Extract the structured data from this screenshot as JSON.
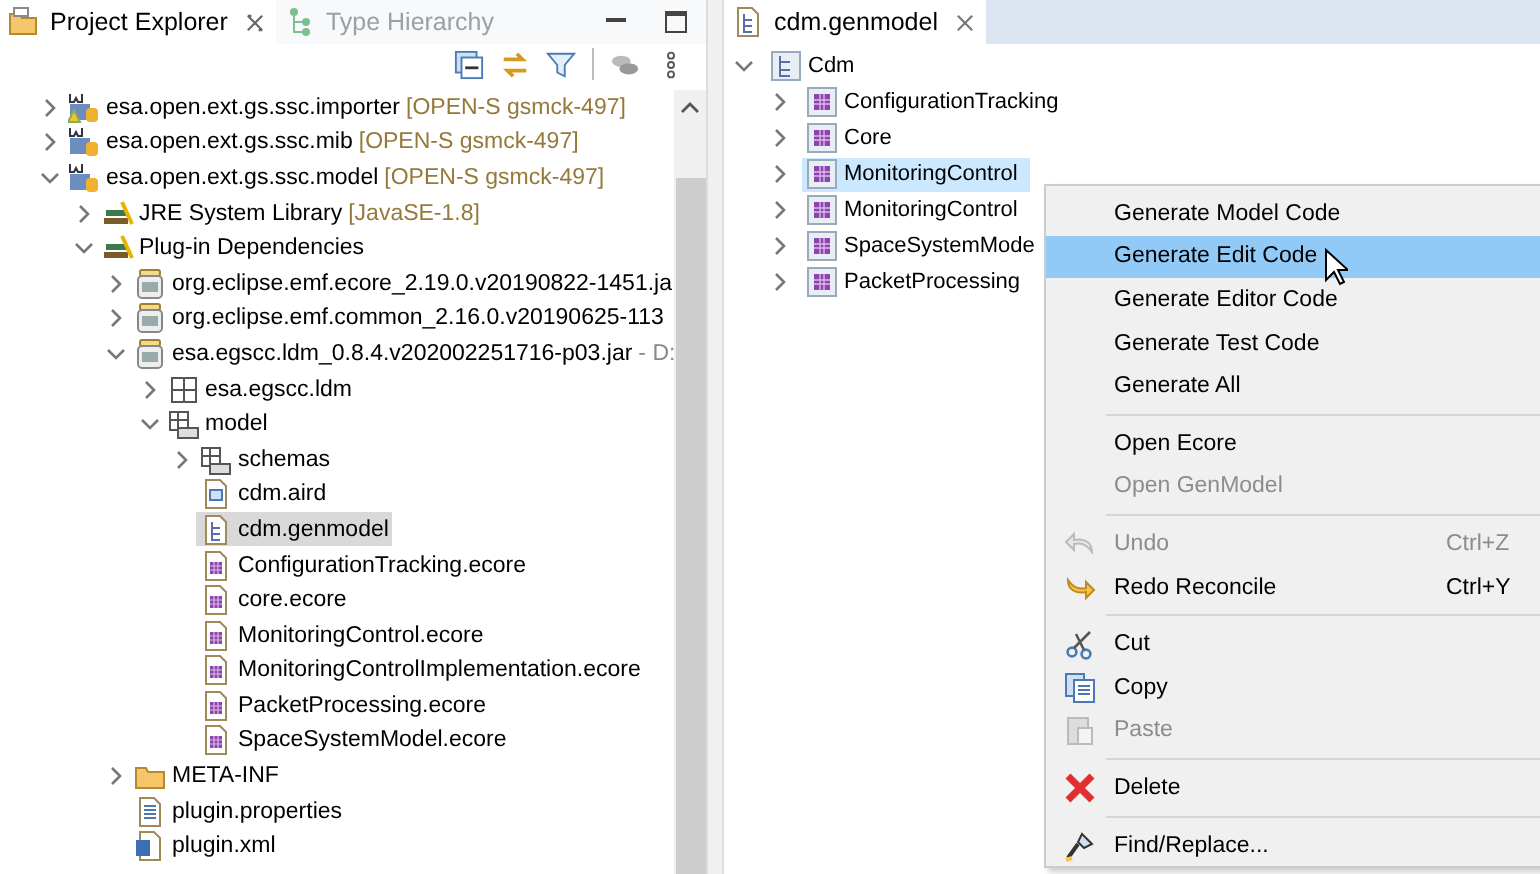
{
  "explorer": {
    "tabs": [
      {
        "label": "Project Explorer",
        "selected": true
      },
      {
        "label": "Type Hierarchy",
        "selected": false
      }
    ],
    "tree": [
      {
        "label": "esa.open.ext.gs.ssc.importer",
        "decoration": "[OPEN-S gsmck-497]",
        "kind": "project-warning",
        "expanded": false,
        "selected": false
      },
      {
        "label": "esa.open.ext.gs.ssc.mib",
        "decoration": "[OPEN-S gsmck-497]",
        "kind": "project",
        "expanded": false,
        "selected": false
      },
      {
        "label": "esa.open.ext.gs.ssc.model",
        "decoration": "[OPEN-S gsmck-497]",
        "kind": "project",
        "expanded": true,
        "selected": false,
        "children": [
          {
            "label": "JRE System Library",
            "decoration": "[JavaSE-1.8]",
            "kind": "library",
            "expanded": false,
            "selected": false
          },
          {
            "label": "Plug-in Dependencies",
            "kind": "library",
            "expanded": true,
            "selected": false,
            "children": [
              {
                "label": "org.eclipse.emf.ecore_2.19.0.v20190822-1451.ja",
                "kind": "jar",
                "expanded": false,
                "selected": false
              },
              {
                "label": "org.eclipse.emf.common_2.16.0.v20190625-113",
                "kind": "jar",
                "expanded": false,
                "selected": false
              },
              {
                "label": "esa.egscc.ldm_0.8.4.v202002251716-p03.jar",
                "decoration": "- D:",
                "kind": "jar",
                "expanded": true,
                "selected": false,
                "children": [
                  {
                    "label": "esa.egscc.ldm",
                    "kind": "package",
                    "expanded": false,
                    "selected": false
                  },
                  {
                    "label": "model",
                    "kind": "package-folder",
                    "expanded": true,
                    "selected": false,
                    "children": [
                      {
                        "label": "schemas",
                        "kind": "package-folder",
                        "expanded": false,
                        "selected": false
                      },
                      {
                        "label": "cdm.aird",
                        "kind": "file-diagram",
                        "selected": false
                      },
                      {
                        "label": "cdm.genmodel",
                        "kind": "file-genmodel",
                        "selected": true
                      },
                      {
                        "label": "ConfigurationTracking.ecore",
                        "kind": "file-ecore",
                        "selected": false
                      },
                      {
                        "label": "core.ecore",
                        "kind": "file-ecore",
                        "selected": false
                      },
                      {
                        "label": "MonitoringControl.ecore",
                        "kind": "file-ecore",
                        "selected": false
                      },
                      {
                        "label": "MonitoringControlImplementation.ecore",
                        "kind": "file-ecore",
                        "selected": false
                      },
                      {
                        "label": "PacketProcessing.ecore",
                        "kind": "file-ecore",
                        "selected": false
                      },
                      {
                        "label": "SpaceSystemModel.ecore",
                        "kind": "file-ecore",
                        "selected": false
                      }
                    ]
                  }
                ]
              },
              {
                "label": "META-INF",
                "kind": "folder",
                "expanded": false,
                "selected": false
              },
              {
                "label": "plugin.properties",
                "kind": "file-text",
                "selected": false
              },
              {
                "label": "plugin.xml",
                "kind": "file-xml",
                "selected": false
              }
            ]
          }
        ]
      }
    ]
  },
  "editor": {
    "tabs": [
      {
        "label": "cdm.genmodel",
        "selected": true
      }
    ],
    "tree": [
      {
        "label": "Cdm",
        "kind": "genmodel",
        "expanded": true,
        "selected": false,
        "children": [
          {
            "label": "ConfigurationTracking",
            "kind": "package",
            "expanded": false,
            "selected": false
          },
          {
            "label": "Core",
            "kind": "package",
            "expanded": false,
            "selected": false
          },
          {
            "label": "MonitoringControl",
            "kind": "package",
            "expanded": false,
            "selected": true
          },
          {
            "label": "MonitoringControl",
            "kind": "package",
            "expanded": false,
            "selected": false
          },
          {
            "label": "SpaceSystemMode",
            "kind": "package",
            "expanded": false,
            "selected": false
          },
          {
            "label": "PacketProcessing",
            "kind": "package",
            "expanded": false,
            "selected": false
          }
        ]
      }
    ]
  },
  "context_menu": {
    "items": [
      {
        "kind": "plain",
        "label": "Generate Model Code",
        "disabled": false,
        "selected": false
      },
      {
        "kind": "plain",
        "label": "Generate Edit Code",
        "disabled": false,
        "selected": true
      },
      {
        "kind": "plain",
        "label": "Generate Editor Code",
        "disabled": false,
        "selected": false
      },
      {
        "kind": "plain",
        "label": "Generate Test Code",
        "disabled": false,
        "selected": false
      },
      {
        "kind": "plain",
        "label": "Generate All",
        "disabled": false,
        "selected": false
      },
      {
        "kind": "separator"
      },
      {
        "kind": "plain",
        "label": "Open Ecore",
        "disabled": false,
        "selected": false
      },
      {
        "kind": "plain",
        "label": "Open GenModel",
        "disabled": true,
        "selected": false
      },
      {
        "kind": "separator"
      },
      {
        "kind": "undo",
        "label": "Undo",
        "shortcut": "Ctrl+Z",
        "disabled": true,
        "selected": false
      },
      {
        "kind": "redo",
        "label": "Redo Reconcile",
        "shortcut": "Ctrl+Y",
        "disabled": false,
        "selected": false
      },
      {
        "kind": "separator"
      },
      {
        "kind": "cut",
        "label": "Cut",
        "disabled": false,
        "selected": false
      },
      {
        "kind": "copy",
        "label": "Copy",
        "disabled": false,
        "selected": false
      },
      {
        "kind": "paste",
        "label": "Paste",
        "disabled": true,
        "selected": false
      },
      {
        "kind": "separator"
      },
      {
        "kind": "delete",
        "label": "Delete",
        "disabled": false,
        "selected": false
      },
      {
        "kind": "separator"
      },
      {
        "kind": "find",
        "label": "Find/Replace...",
        "disabled": false,
        "selected": false
      }
    ]
  }
}
